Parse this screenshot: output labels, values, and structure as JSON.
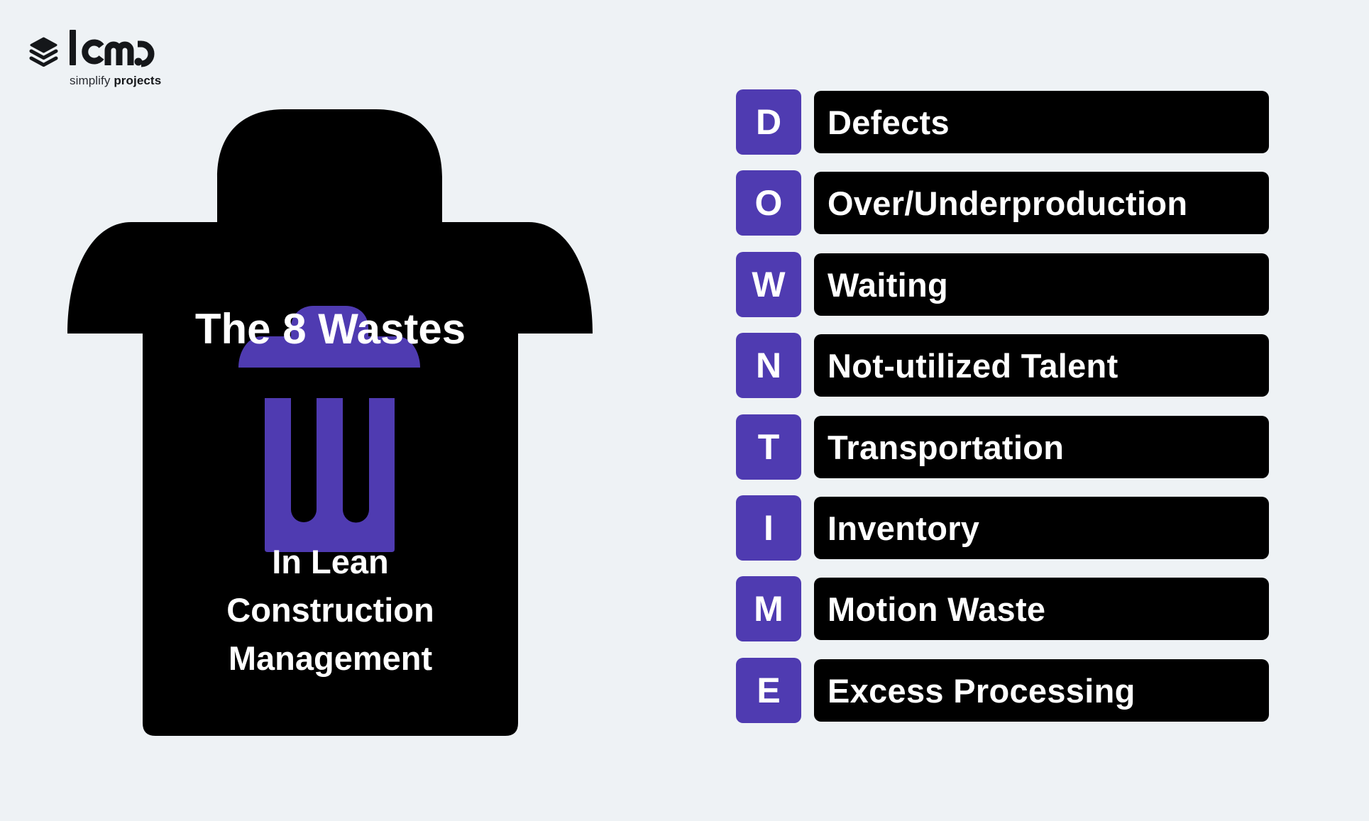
{
  "brand": {
    "logo_text": "lcmd",
    "tagline_regular": "simplify",
    "tagline_bold": "projects",
    "logo_icon": "layers-icon"
  },
  "colors": {
    "background": "#EEF2F5",
    "accent_purple": "#4F3BB1",
    "bin_black": "#000000",
    "text_white": "#FFFFFF"
  },
  "bin": {
    "title": "The 8 Wastes",
    "icon": "trash-can-icon",
    "subtitle_lines": [
      "In Lean",
      "Construction",
      "Management"
    ]
  },
  "wastes": [
    {
      "letter": "D",
      "label": "Defects"
    },
    {
      "letter": "O",
      "label": "Over/Underproduction"
    },
    {
      "letter": "W",
      "label": "Waiting"
    },
    {
      "letter": "N",
      "label": "Not-utilized Talent"
    },
    {
      "letter": "T",
      "label": "Transportation"
    },
    {
      "letter": "I",
      "label": "Inventory"
    },
    {
      "letter": "M",
      "label": "Motion Waste"
    },
    {
      "letter": "E",
      "label": "Excess Processing"
    }
  ]
}
